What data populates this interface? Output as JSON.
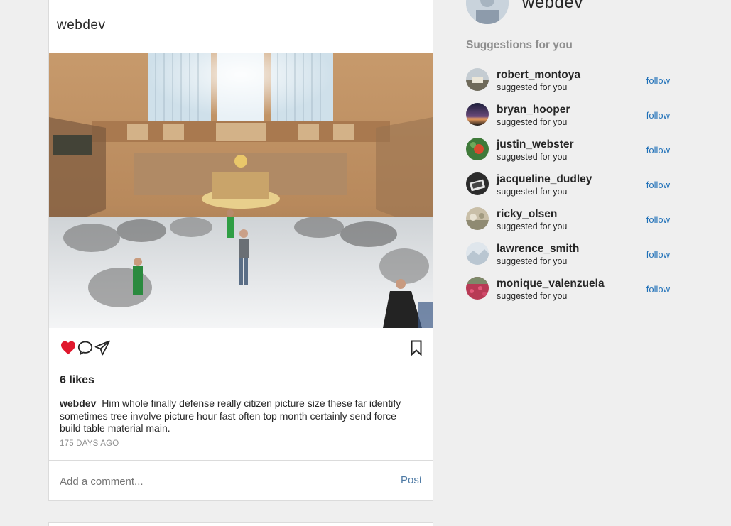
{
  "post": {
    "author": "webdev",
    "photo_alt": "",
    "likes": "6 likes",
    "caption_user": "webdev",
    "caption_text": "Him whole finally defense really citizen picture size these far identify sometimes tree involve picture hour fast often top month certainly send force build table material main.",
    "time": "175 DAYS AGO",
    "liked": true,
    "comment_placeholder": "Add a comment...",
    "post_label": "Post"
  },
  "icons": {
    "like": "heart-icon",
    "comment": "comment-icon",
    "share": "send-icon",
    "save": "bookmark-icon"
  },
  "colors": {
    "like_red": "#e0182d",
    "link_blue": "#1f70b8",
    "post_blue": "#4f7ba5",
    "muted": "#8e8e8e",
    "background": "#efefef"
  },
  "profile": {
    "username": "webdev"
  },
  "suggestions": {
    "title": "Suggestions for you",
    "items": [
      {
        "username": "robert_montoya",
        "subtitle": "suggested for you",
        "action": "follow"
      },
      {
        "username": "bryan_hooper",
        "subtitle": "suggested for you",
        "action": "follow"
      },
      {
        "username": "justin_webster",
        "subtitle": "suggested for you",
        "action": "follow"
      },
      {
        "username": "jacqueline_dudley",
        "subtitle": "suggested for you",
        "action": "follow"
      },
      {
        "username": "ricky_olsen",
        "subtitle": "suggested for you",
        "action": "follow"
      },
      {
        "username": "lawrence_smith",
        "subtitle": "suggested for you",
        "action": "follow"
      },
      {
        "username": "monique_valenzuela",
        "subtitle": "suggested for you",
        "action": "follow"
      }
    ]
  }
}
